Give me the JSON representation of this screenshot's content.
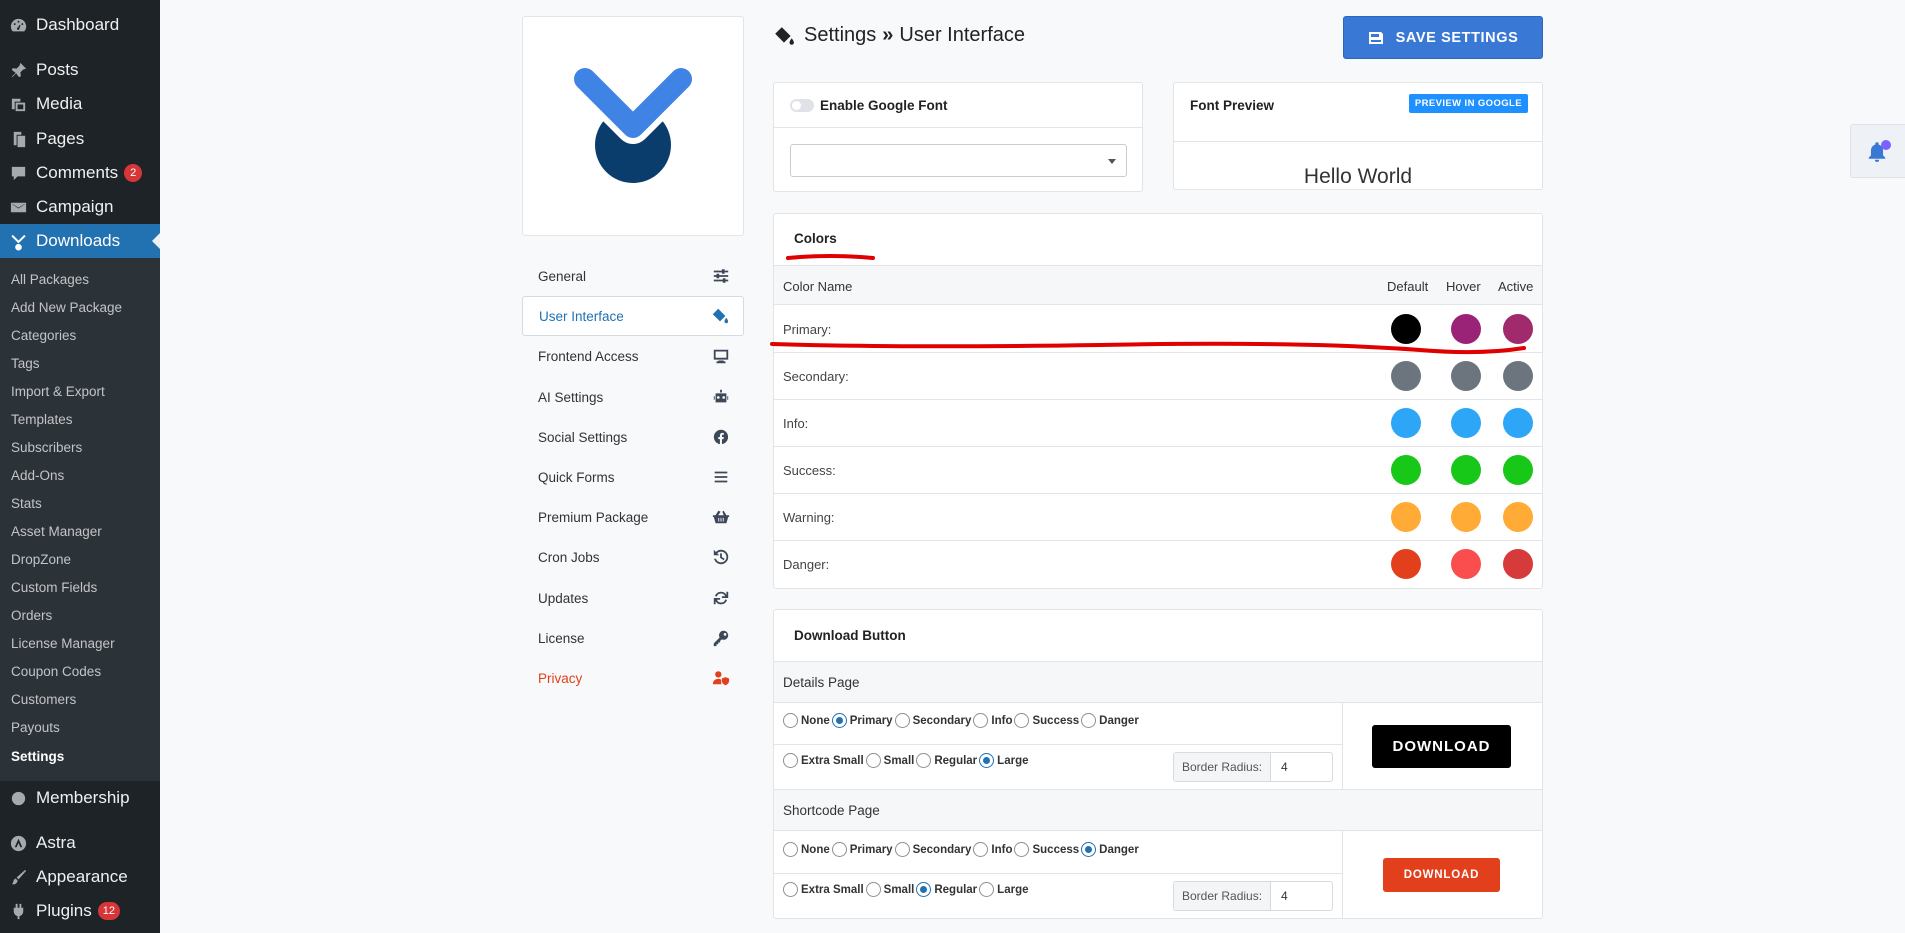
{
  "admin_menu": {
    "top_items": [
      {
        "label": "Dashboard",
        "icon": "dashboard-icon"
      },
      {
        "label": "Posts",
        "icon": "pin-icon"
      },
      {
        "label": "Media",
        "icon": "media-icon"
      },
      {
        "label": "Pages",
        "icon": "pages-icon"
      },
      {
        "label": "Comments",
        "icon": "comment-icon",
        "badge": "2"
      },
      {
        "label": "Campaign",
        "icon": "mail-icon"
      },
      {
        "label": "Downloads",
        "icon": "downloads-icon"
      }
    ],
    "sub_items": [
      "All Packages",
      "Add New Package",
      "Categories",
      "Tags",
      "Import & Export",
      "Templates",
      "Subscribers",
      "Add-Ons",
      "Stats",
      "Asset Manager",
      "DropZone",
      "Custom Fields",
      "Orders",
      "License Manager",
      "Coupon Codes",
      "Customers",
      "Payouts",
      "Settings"
    ],
    "bottom_items": [
      {
        "label": "Membership",
        "icon": "membership-icon"
      },
      {
        "label": "Astra",
        "icon": "astra-icon"
      },
      {
        "label": "Appearance",
        "icon": "brush-icon"
      },
      {
        "label": "Plugins",
        "icon": "plugin-icon",
        "badge": "12"
      }
    ]
  },
  "settings_nav": [
    {
      "label": "General",
      "icon": "sliders-icon"
    },
    {
      "label": "User Interface",
      "icon": "paint-bucket-icon"
    },
    {
      "label": "Frontend Access",
      "icon": "desktop-icon"
    },
    {
      "label": "AI Settings",
      "icon": "robot-icon"
    },
    {
      "label": "Social Settings",
      "icon": "facebook-icon"
    },
    {
      "label": "Quick Forms",
      "icon": "bars-icon"
    },
    {
      "label": "Premium Package",
      "icon": "basket-icon"
    },
    {
      "label": "Cron Jobs",
      "icon": "history-icon"
    },
    {
      "label": "Updates",
      "icon": "sync-icon"
    },
    {
      "label": "License",
      "icon": "key-icon"
    },
    {
      "label": "Privacy",
      "icon": "user-shield-icon"
    }
  ],
  "header": {
    "title": "Settings",
    "separator": "»",
    "subtitle": "User Interface",
    "save_label": "SAVE SETTINGS"
  },
  "google_font": {
    "label": "Enable Google Font",
    "enabled": false,
    "selected": ""
  },
  "font_preview": {
    "title": "Font Preview",
    "button": "PREVIEW IN GOOGLE",
    "sample": "Hello World"
  },
  "colors": {
    "title": "Colors",
    "headers": {
      "name": "Color Name",
      "default": "Default",
      "hover": "Hover",
      "active": "Active"
    },
    "rows": [
      {
        "name": "Primary:",
        "default": "#000000",
        "hover": "#9b2377",
        "active": "#a02a6c"
      },
      {
        "name": "Secondary:",
        "default": "#6c757d",
        "hover": "#6c757d",
        "active": "#6c757d"
      },
      {
        "name": "Info:",
        "default": "#2ea6f7",
        "hover": "#2ea6f7",
        "active": "#2ea6f7"
      },
      {
        "name": "Success:",
        "default": "#18c818",
        "hover": "#18c818",
        "active": "#18c818"
      },
      {
        "name": "Warning:",
        "default": "#ffab36",
        "hover": "#ffab36",
        "active": "#ffab36"
      },
      {
        "name": "Danger:",
        "default": "#e2401c",
        "hover": "#fa4d4d",
        "active": "#d73a3a"
      }
    ]
  },
  "download_button": {
    "title": "Download Button",
    "details_page": {
      "title": "Details Page",
      "styles": [
        "None",
        "Primary",
        "Secondary",
        "Info",
        "Success",
        "Danger"
      ],
      "selected_style": "Primary",
      "sizes": [
        "Extra Small",
        "Small",
        "Regular",
        "Large"
      ],
      "selected_size": "Large",
      "border_radius_label": "Border Radius:",
      "border_radius": "4",
      "preview_label": "DOWNLOAD"
    },
    "shortcode_page": {
      "title": "Shortcode Page",
      "styles": [
        "None",
        "Primary",
        "Secondary",
        "Info",
        "Success",
        "Danger"
      ],
      "selected_style": "Danger",
      "sizes": [
        "Extra Small",
        "Small",
        "Regular",
        "Large"
      ],
      "selected_size": "Regular",
      "border_radius_label": "Border Radius:",
      "border_radius": "4",
      "preview_label": "DOWNLOAD"
    }
  },
  "notifications": {
    "count": "1"
  }
}
